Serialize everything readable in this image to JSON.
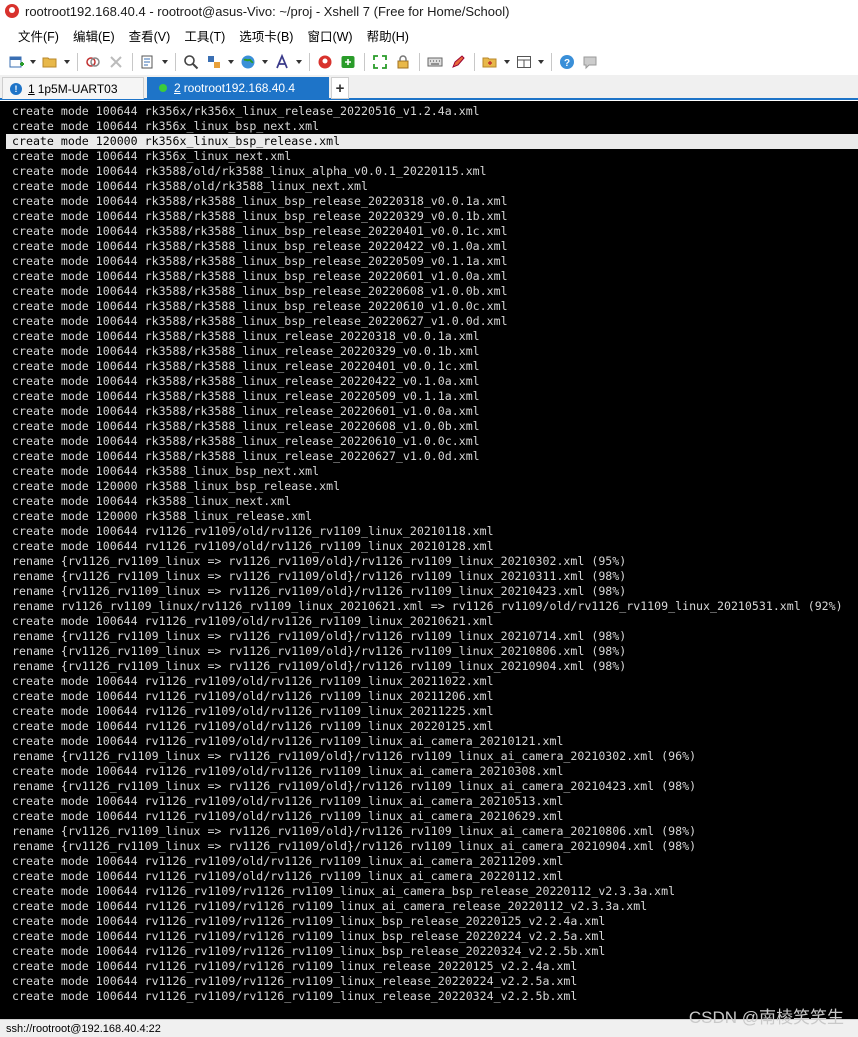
{
  "window": {
    "title": "rootroot192.168.40.4 - rootroot@asus-Vivo: ~/proj - Xshell 7 (Free for Home/School)",
    "app_icon": "xshell-logo-icon"
  },
  "menu": [
    "文件(F)",
    "编辑(E)",
    "查看(V)",
    "工具(T)",
    "选项卡(B)",
    "窗口(W)",
    "帮助(H)"
  ],
  "tabs": [
    {
      "num": "1",
      "label": "1p5M-UART03",
      "icon": "warning-icon"
    },
    {
      "num": "2",
      "label": "rootroot192.168.40.4",
      "icon": "connected-dot-icon"
    }
  ],
  "tab_add_label": "+",
  "terminal_lines": [
    "create mode 100644 rk356x/rk356x_linux_release_20220516_v1.2.4a.xml",
    "create mode 100644 rk356x_linux_bsp_next.xml",
    "create mode 120000 rk356x_linux_bsp_release.xml",
    "create mode 100644 rk356x_linux_next.xml",
    "create mode 100644 rk3588/old/rk3588_linux_alpha_v0.0.1_20220115.xml",
    "create mode 100644 rk3588/old/rk3588_linux_next.xml",
    "create mode 100644 rk3588/rk3588_linux_bsp_release_20220318_v0.0.1a.xml",
    "create mode 100644 rk3588/rk3588_linux_bsp_release_20220329_v0.0.1b.xml",
    "create mode 100644 rk3588/rk3588_linux_bsp_release_20220401_v0.0.1c.xml",
    "create mode 100644 rk3588/rk3588_linux_bsp_release_20220422_v0.1.0a.xml",
    "create mode 100644 rk3588/rk3588_linux_bsp_release_20220509_v0.1.1a.xml",
    "create mode 100644 rk3588/rk3588_linux_bsp_release_20220601_v1.0.0a.xml",
    "create mode 100644 rk3588/rk3588_linux_bsp_release_20220608_v1.0.0b.xml",
    "create mode 100644 rk3588/rk3588_linux_bsp_release_20220610_v1.0.0c.xml",
    "create mode 100644 rk3588/rk3588_linux_bsp_release_20220627_v1.0.0d.xml",
    "create mode 100644 rk3588/rk3588_linux_release_20220318_v0.0.1a.xml",
    "create mode 100644 rk3588/rk3588_linux_release_20220329_v0.0.1b.xml",
    "create mode 100644 rk3588/rk3588_linux_release_20220401_v0.0.1c.xml",
    "create mode 100644 rk3588/rk3588_linux_release_20220422_v0.1.0a.xml",
    "create mode 100644 rk3588/rk3588_linux_release_20220509_v0.1.1a.xml",
    "create mode 100644 rk3588/rk3588_linux_release_20220601_v1.0.0a.xml",
    "create mode 100644 rk3588/rk3588_linux_release_20220608_v1.0.0b.xml",
    "create mode 100644 rk3588/rk3588_linux_release_20220610_v1.0.0c.xml",
    "create mode 100644 rk3588/rk3588_linux_release_20220627_v1.0.0d.xml",
    "create mode 100644 rk3588_linux_bsp_next.xml",
    "create mode 120000 rk3588_linux_bsp_release.xml",
    "create mode 100644 rk3588_linux_next.xml",
    "create mode 120000 rk3588_linux_release.xml",
    "create mode 100644 rv1126_rv1109/old/rv1126_rv1109_linux_20210118.xml",
    "create mode 100644 rv1126_rv1109/old/rv1126_rv1109_linux_20210128.xml",
    "rename {rv1126_rv1109_linux => rv1126_rv1109/old}/rv1126_rv1109_linux_20210302.xml (95%)",
    "rename {rv1126_rv1109_linux => rv1126_rv1109/old}/rv1126_rv1109_linux_20210311.xml (98%)",
    "rename {rv1126_rv1109_linux => rv1126_rv1109/old}/rv1126_rv1109_linux_20210423.xml (98%)",
    "rename rv1126_rv1109_linux/rv1126_rv1109_linux_20210621.xml => rv1126_rv1109/old/rv1126_rv1109_linux_20210531.xml (92%)",
    "create mode 100644 rv1126_rv1109/old/rv1126_rv1109_linux_20210621.xml",
    "rename {rv1126_rv1109_linux => rv1126_rv1109/old}/rv1126_rv1109_linux_20210714.xml (98%)",
    "rename {rv1126_rv1109_linux => rv1126_rv1109/old}/rv1126_rv1109_linux_20210806.xml (98%)",
    "rename {rv1126_rv1109_linux => rv1126_rv1109/old}/rv1126_rv1109_linux_20210904.xml (98%)",
    "create mode 100644 rv1126_rv1109/old/rv1126_rv1109_linux_20211022.xml",
    "create mode 100644 rv1126_rv1109/old/rv1126_rv1109_linux_20211206.xml",
    "create mode 100644 rv1126_rv1109/old/rv1126_rv1109_linux_20211225.xml",
    "create mode 100644 rv1126_rv1109/old/rv1126_rv1109_linux_20220125.xml",
    "create mode 100644 rv1126_rv1109/old/rv1126_rv1109_linux_ai_camera_20210121.xml",
    "rename {rv1126_rv1109_linux => rv1126_rv1109/old}/rv1126_rv1109_linux_ai_camera_20210302.xml (96%)",
    "create mode 100644 rv1126_rv1109/old/rv1126_rv1109_linux_ai_camera_20210308.xml",
    "rename {rv1126_rv1109_linux => rv1126_rv1109/old}/rv1126_rv1109_linux_ai_camera_20210423.xml (98%)",
    "create mode 100644 rv1126_rv1109/old/rv1126_rv1109_linux_ai_camera_20210513.xml",
    "create mode 100644 rv1126_rv1109/old/rv1126_rv1109_linux_ai_camera_20210629.xml",
    "rename {rv1126_rv1109_linux => rv1126_rv1109/old}/rv1126_rv1109_linux_ai_camera_20210806.xml (98%)",
    "rename {rv1126_rv1109_linux => rv1126_rv1109/old}/rv1126_rv1109_linux_ai_camera_20210904.xml (98%)",
    "create mode 100644 rv1126_rv1109/old/rv1126_rv1109_linux_ai_camera_20211209.xml",
    "create mode 100644 rv1126_rv1109/old/rv1126_rv1109_linux_ai_camera_20220112.xml",
    "create mode 100644 rv1126_rv1109/rv1126_rv1109_linux_ai_camera_bsp_release_20220112_v2.3.3a.xml",
    "create mode 100644 rv1126_rv1109/rv1126_rv1109_linux_ai_camera_release_20220112_v2.3.3a.xml",
    "create mode 100644 rv1126_rv1109/rv1126_rv1109_linux_bsp_release_20220125_v2.2.4a.xml",
    "create mode 100644 rv1126_rv1109/rv1126_rv1109_linux_bsp_release_20220224_v2.2.5a.xml",
    "create mode 100644 rv1126_rv1109/rv1126_rv1109_linux_bsp_release_20220324_v2.2.5b.xml",
    "create mode 100644 rv1126_rv1109/rv1126_rv1109_linux_release_20220125_v2.2.4a.xml",
    "create mode 100644 rv1126_rv1109/rv1126_rv1109_linux_release_20220224_v2.2.5a.xml",
    "create mode 100644 rv1126_rv1109/rv1126_rv1109_linux_release_20220324_v2.2.5b.xml"
  ],
  "highlighted_line_index": 2,
  "status": {
    "connection": "ssh://rootroot@192.168.40.4:22"
  },
  "watermark": "CSDN @南棱笑笑生",
  "colors": {
    "terminal_bg": "#000000",
    "terminal_fg": "#d7d7d7",
    "tab_active": "#1e74c8",
    "connected": "#3ccc3c"
  }
}
